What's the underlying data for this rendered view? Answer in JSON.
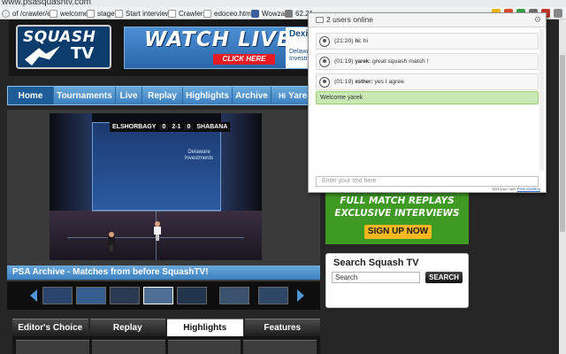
{
  "browser": {
    "url": "www.psasquashtv.com",
    "bookmarks": [
      {
        "label": "of /crawler/e...",
        "icon": "globe-icon"
      },
      {
        "label": "welcome",
        "icon": "page-icon"
      },
      {
        "label": "stage",
        "icon": "page-icon"
      },
      {
        "label": "Start interview",
        "icon": "page-icon"
      },
      {
        "label": "Crawler",
        "icon": "page-icon"
      },
      {
        "label": "edoceo.html",
        "icon": "page-icon"
      },
      {
        "label": "Wowza",
        "icon": "wowza-icon"
      },
      {
        "label": "62.21",
        "icon": "ip-icon"
      }
    ]
  },
  "site": {
    "logo_top": "SQUASH",
    "logo_bottom": "TV",
    "banner": {
      "headline": "WATCH LIVE",
      "cta": "CLICK HERE",
      "sponsor_name": "Dexia",
      "sponsor_text": "Delaware Investmen"
    },
    "nav": [
      {
        "label": "Home",
        "active": true
      },
      {
        "label": "Tournaments",
        "active": false
      },
      {
        "label": "Live",
        "active": false
      },
      {
        "label": "Replay",
        "active": false
      },
      {
        "label": "Highlights",
        "active": false
      },
      {
        "label": "Archive",
        "active": false
      }
    ],
    "user_greeting": "Hi",
    "user_name": "Yarek",
    "scoreboard": {
      "player1": "ELSHORBAGY",
      "score": "2-1",
      "player2": "SHABANA",
      "p1_game": "0",
      "p2_game": "0"
    },
    "court_ad": "Delaware Investments",
    "archive_title": "PSA Archive - Matches from before SquashTV!",
    "tabs": [
      {
        "label": "Editor's Choice",
        "active": false
      },
      {
        "label": "Replay",
        "active": false
      },
      {
        "label": "Highlights",
        "active": true
      },
      {
        "label": "Features",
        "active": false
      }
    ],
    "promo": {
      "line1": "FULL MATCH REPLAYS",
      "line2": "EXCLUSIVE INTERVIEWS",
      "button": "SIGN UP NOW"
    },
    "search": {
      "title": "Search Squash TV",
      "placeholder": "Search",
      "button": "SEARCH"
    }
  },
  "chat": {
    "header": "2 users online",
    "messages": [
      {
        "time": "(21:20)",
        "user": "hi:",
        "text": "hi"
      },
      {
        "time": "(01:19)",
        "user": "yarek:",
        "text": "great squash match !"
      },
      {
        "time": "(01:19)",
        "user": "esther:",
        "text": "yes I agree"
      }
    ],
    "welcome": "Welcome yarek",
    "input_placeholder": "Enter your text here",
    "footer_text": "Get your own",
    "footer_link": "Free chatbox"
  },
  "colors": {
    "nav_blue": "#3c7fc0",
    "promo_green": "#3e9a22",
    "signup_yellow": "#f6b820",
    "welcome_green": "#c9e8b4"
  }
}
